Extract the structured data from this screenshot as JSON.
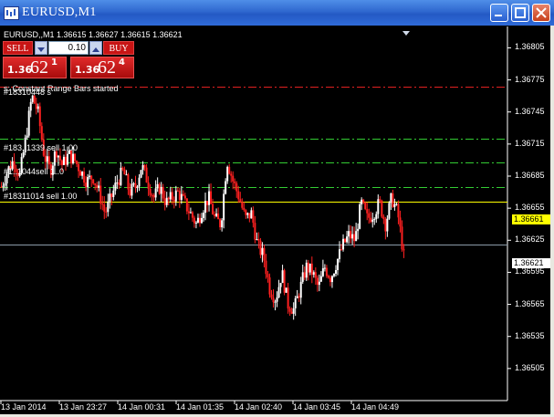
{
  "window": {
    "title": "EURUSD,M1"
  },
  "header": {
    "symbol_line": "EURUSD,,M1  1.36615  1.36627  1.36615  1.36621"
  },
  "trade_panel": {
    "sell_label": "SELL",
    "buy_label": "BUY",
    "lot_value": "0.10",
    "sell_price_main": "1.36",
    "sell_price_big": "62",
    "sell_price_sup": "1",
    "buy_price_main": "1.36",
    "buy_price_big": "62",
    "buy_price_sup": "4"
  },
  "annotations": {
    "status": "s: Constant Range Bars started",
    "order1": "#18310448 s",
    "order2": "#183..1339 sell 1.00",
    "order3": "#1..1044sell 1..0",
    "order4": "#18311014 sell 1.00"
  },
  "price_tags": {
    "yellow": "1.36661",
    "current": "1.36621"
  },
  "colors": {
    "red_line": "#e02020",
    "green_line": "#33cc33",
    "yellow_line": "#ffff00",
    "bid_line": "#8a9aa8",
    "bull": "#ffffff",
    "bear": "#ff2020"
  },
  "chart_data": {
    "type": "candlestick",
    "symbol": "EURUSD",
    "timeframe": "M1",
    "ylim": [
      1.36475,
      1.36825
    ],
    "y_ticks": [
      "1.36805",
      "1.36775",
      "1.36745",
      "1.36715",
      "1.36685",
      "1.36655",
      "1.36625",
      "1.36595",
      "1.36565",
      "1.36535",
      "1.36505"
    ],
    "x_ticks": [
      "13 Jan 2014",
      "13 Jan 23:27",
      "14 Jan 00:31",
      "14 Jan 01:35",
      "14 Jan 02:40",
      "14 Jan 03:45",
      "14 Jan 04:49"
    ],
    "levels": [
      {
        "kind": "red-dash",
        "price": 1.36769
      },
      {
        "kind": "green-dash",
        "price": 1.3672
      },
      {
        "kind": "green-dash",
        "price": 1.36698
      },
      {
        "kind": "green-dash",
        "price": 1.36675
      },
      {
        "kind": "yellow",
        "price": 1.36661
      },
      {
        "kind": "bid",
        "price": 1.36621
      }
    ],
    "close_path": [
      1.36675,
      1.3669,
      1.367,
      1.36685,
      1.3672,
      1.3676,
      1.36745,
      1.36705,
      1.3669,
      1.3671,
      1.36695,
      1.36705,
      1.367,
      1.3669,
      1.3668,
      1.36685,
      1.3667,
      1.3665,
      1.36665,
      1.3668,
      1.3669,
      1.3667,
      1.36675,
      1.36695,
      1.3668,
      1.36665,
      1.36675,
      1.3666,
      1.36665,
      1.3667,
      1.3666,
      1.3665,
      1.3664,
      1.36655,
      1.36665,
      1.36645,
      1.3664,
      1.367,
      1.3668,
      1.36665,
      1.36645,
      1.3665,
      1.3662,
      1.3661,
      1.3658,
      1.3657,
      1.36595,
      1.36565,
      1.3656,
      1.3658,
      1.366,
      1.36595,
      1.3658,
      1.366,
      1.3659,
      1.36605,
      1.3662,
      1.3663,
      1.36625,
      1.3666,
      1.36645,
      1.3665,
      1.3666,
      1.3664,
      1.36665,
      1.3665,
      1.3661
    ]
  }
}
